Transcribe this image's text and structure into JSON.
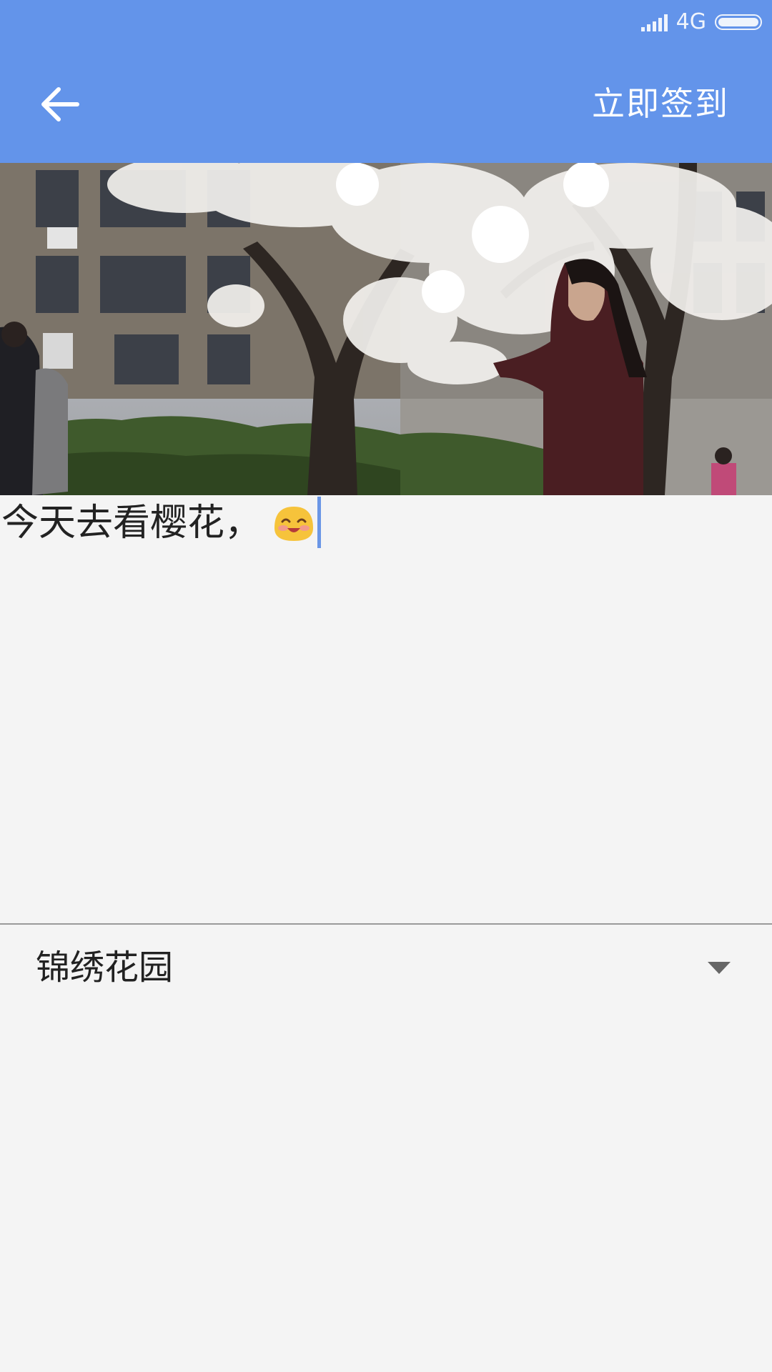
{
  "status_bar": {
    "network": "4G",
    "icons": [
      "signal-icon",
      "battery-icon"
    ]
  },
  "app_bar": {
    "back_icon": "arrow-left-icon",
    "action_label": "立即签到",
    "color": "#6394ea"
  },
  "post": {
    "text": "今天去看樱花，",
    "emoji": "smiling-face-icon",
    "cursor_color": "#6a96e6"
  },
  "location": {
    "selected": "锦绣花园",
    "icon": "triangle-down-icon"
  }
}
